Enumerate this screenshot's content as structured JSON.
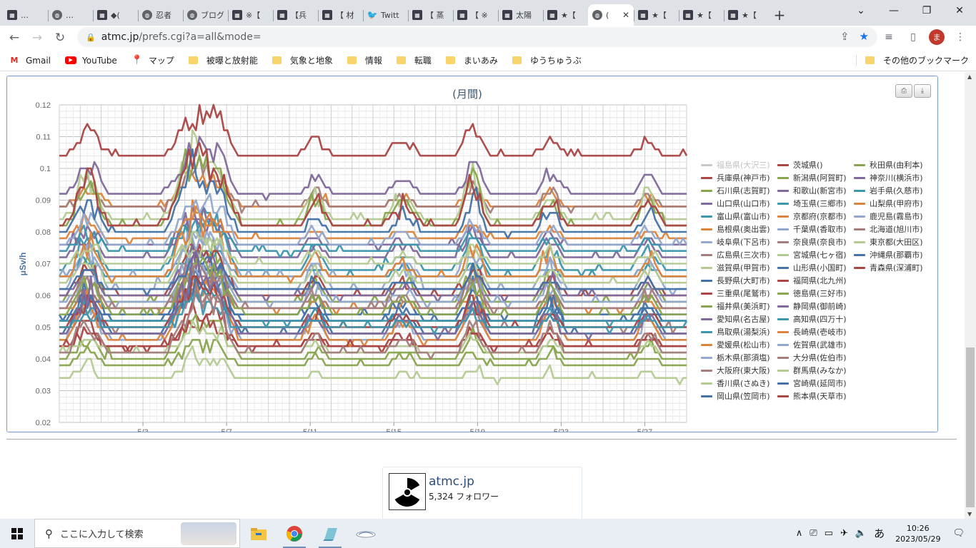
{
  "browser": {
    "tabs": [
      {
        "title": "…",
        "icon": "site-square-icon"
      },
      {
        "title": "…",
        "icon": "globe-icon"
      },
      {
        "title": "◆(",
        "icon": "site-square-icon"
      },
      {
        "title": "忍者",
        "icon": "globe-icon"
      },
      {
        "title": "ブログ",
        "icon": "globe-icon"
      },
      {
        "title": "※【",
        "icon": "site-square-icon"
      },
      {
        "title": "【兵",
        "icon": "site-square-icon"
      },
      {
        "title": "【 材",
        "icon": "site-square-icon"
      },
      {
        "title": "Twitt",
        "icon": "twitter-icon"
      },
      {
        "title": "【 蒸",
        "icon": "site-square-icon"
      },
      {
        "title": "【 ※",
        "icon": "site-square-icon"
      },
      {
        "title": "太陽",
        "icon": "site-square-icon"
      },
      {
        "title": "★【",
        "icon": "site-square-icon"
      },
      {
        "title": "(",
        "icon": "globe-icon",
        "active": true
      },
      {
        "title": "★【",
        "icon": "site-square-icon"
      },
      {
        "title": "★【",
        "icon": "site-square-icon"
      },
      {
        "title": "★【",
        "icon": "site-square-icon"
      }
    ],
    "url_host": "atmc.jp",
    "url_path": "/prefs.cgi?a=all&mode=",
    "profile_initial": "ま",
    "bookmarks": [
      {
        "label": "Gmail",
        "icon": "gmail-icon"
      },
      {
        "label": "YouTube",
        "icon": "youtube-icon"
      },
      {
        "label": "マップ",
        "icon": "maps-icon"
      },
      {
        "label": "被曝と放射能",
        "icon": "folder-icon"
      },
      {
        "label": "気象と地象",
        "icon": "folder-icon"
      },
      {
        "label": "情報",
        "icon": "folder-icon"
      },
      {
        "label": "転職",
        "icon": "folder-icon"
      },
      {
        "label": "まいあみ",
        "icon": "folder-icon"
      },
      {
        "label": "ゆうちゅうぶ",
        "icon": "folder-icon"
      }
    ],
    "other_bookmarks": "その他のブックマーク"
  },
  "chart_data": {
    "type": "line",
    "title": "(月間)",
    "ylabel": "μSv/h",
    "xlabel": "",
    "ylim": [
      0.02,
      0.12
    ],
    "yticks": [
      "0.12",
      "0.11",
      "0.1",
      "0.09",
      "0.08",
      "0.07",
      "0.06",
      "0.05",
      "0.04",
      "0.03",
      "0.02"
    ],
    "xticks": [
      "5/3",
      "5/7",
      "5/11",
      "5/15",
      "5/19",
      "5/23",
      "5/27"
    ],
    "x_start": "4/29",
    "x_end": "5/29",
    "grid": true,
    "legend_position": "right",
    "series": [
      {
        "name": "福島県(大沢三)",
        "color": "#c8c8c8",
        "base": null,
        "hidden": true
      },
      {
        "name": "兵庫県(神戸市)",
        "color": "#aa4643",
        "base": 0.104
      },
      {
        "name": "石川県(志賀町)",
        "color": "#89a54e",
        "base": 0.058
      },
      {
        "name": "山口県(山口市)",
        "color": "#80699b",
        "base": 0.075
      },
      {
        "name": "富山県(富山市)",
        "color": "#3d96ae",
        "base": 0.068
      },
      {
        "name": "島根県(奥出雲)",
        "color": "#db843d",
        "base": 0.088
      },
      {
        "name": "岐阜県(下呂市)",
        "color": "#92a8cd",
        "base": 0.062
      },
      {
        "name": "広島県(三次市)",
        "color": "#a47d7c",
        "base": 0.087
      },
      {
        "name": "滋賀県(甲賀市)",
        "color": "#b5ca92",
        "base": 0.033
      },
      {
        "name": "長野県(大町市)",
        "color": "#4572a7",
        "base": 0.052
      },
      {
        "name": "三重県(尾鷲市)",
        "color": "#aa4643",
        "base": 0.043
      },
      {
        "name": "福井県(美浜町)",
        "color": "#89a54e",
        "base": 0.04
      },
      {
        "name": "愛知県(名古屋)",
        "color": "#80699b",
        "base": 0.072
      },
      {
        "name": "鳥取県(湯梨浜)",
        "color": "#3d96ae",
        "base": 0.066
      },
      {
        "name": "愛媛県(松山市)",
        "color": "#db843d",
        "base": 0.055
      },
      {
        "name": "栃木県(那須塩)",
        "color": "#92a8cd",
        "base": 0.046
      },
      {
        "name": "大阪府(東大阪)",
        "color": "#a47d7c",
        "base": 0.049
      },
      {
        "name": "香川県(さぬき)",
        "color": "#b5ca92",
        "base": 0.084
      },
      {
        "name": "岡山県(笠岡市)",
        "color": "#4572a7",
        "base": 0.048
      },
      {
        "name": "茨城県()",
        "color": "#aa4643",
        "base": 0.06
      },
      {
        "name": "新潟県(阿賀町)",
        "color": "#89a54e",
        "base": 0.082
      },
      {
        "name": "和歌山(新宮市)",
        "color": "#80699b",
        "base": 0.059
      },
      {
        "name": "埼玉県(三郷市)",
        "color": "#3d96ae",
        "base": 0.074
      },
      {
        "name": "京都府(京都市)",
        "color": "#db843d",
        "base": 0.045
      },
      {
        "name": "千葉県(香取市)",
        "color": "#92a8cd",
        "base": 0.057
      },
      {
        "name": "奈良県(奈良市)",
        "color": "#a47d7c",
        "base": 0.056
      },
      {
        "name": "宮城県(七ヶ宿)",
        "color": "#b5ca92",
        "base": 0.063
      },
      {
        "name": "山形県(小国町)",
        "color": "#4572a7",
        "base": 0.053
      },
      {
        "name": "福岡県(北九州)",
        "color": "#aa4643",
        "base": 0.044
      },
      {
        "name": "徳島県(三好市)",
        "color": "#89a54e",
        "base": 0.038
      },
      {
        "name": "静岡県(御前崎)",
        "color": "#80699b",
        "base": 0.092
      },
      {
        "name": "高知県(四万十)",
        "color": "#3d96ae",
        "base": 0.051
      },
      {
        "name": "長崎県(壱岐市)",
        "color": "#db843d",
        "base": 0.078
      },
      {
        "name": "佐賀県(武雄市)",
        "color": "#92a8cd",
        "base": 0.066
      },
      {
        "name": "大分県(佐伯市)",
        "color": "#a47d7c",
        "base": 0.055
      },
      {
        "name": "群馬県(みなか)",
        "color": "#b5ca92",
        "base": 0.042
      },
      {
        "name": "宮崎県(延岡市)",
        "color": "#4572a7",
        "base": 0.061
      },
      {
        "name": "熊本県(天草市)",
        "color": "#aa4643",
        "base": 0.05
      },
      {
        "name": "秋田県(由利本)",
        "color": "#89a54e",
        "base": 0.054
      },
      {
        "name": "神奈川(横浜市)",
        "color": "#80699b",
        "base": 0.047
      },
      {
        "name": "岩手県(久慈市)",
        "color": "#3d96ae",
        "base": 0.049
      },
      {
        "name": "山梨県(甲府市)",
        "color": "#db843d",
        "base": 0.065
      },
      {
        "name": "鹿児島(霧島市)",
        "color": "#92a8cd",
        "base": 0.076
      },
      {
        "name": "北海道(旭川市)",
        "color": "#a47d7c",
        "base": 0.041
      },
      {
        "name": "東京都(大田区)",
        "color": "#b5ca92",
        "base": 0.07
      },
      {
        "name": "沖縄県(那覇市)",
        "color": "#4572a7",
        "base": 0.079
      },
      {
        "name": "青森県(深浦町)",
        "color": "#aa4643",
        "base": 0.082
      }
    ]
  },
  "follow_card": {
    "name": "atmc.jp",
    "followers": "5,324 フォロワー"
  },
  "taskbar": {
    "search_placeholder": "ここに入力して検索",
    "time": "10:26",
    "date": "2023/05/29",
    "ime": "あ"
  }
}
